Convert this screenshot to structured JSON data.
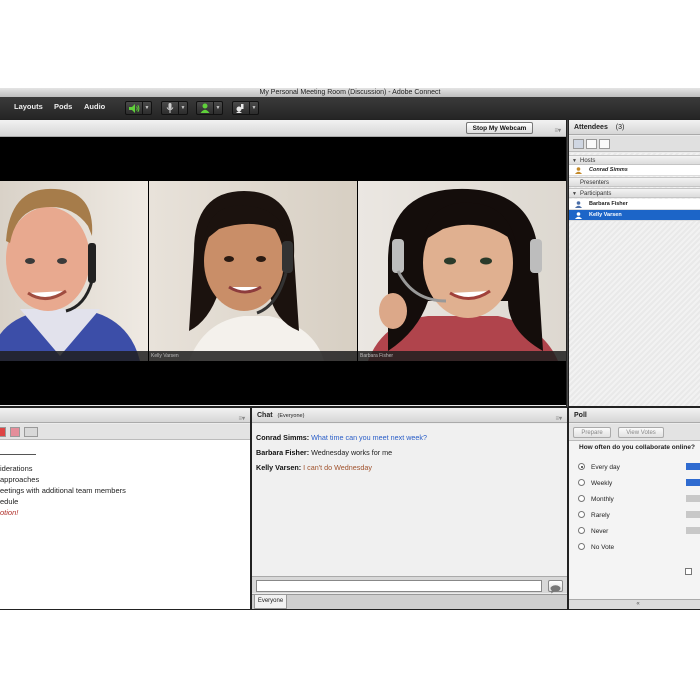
{
  "window": {
    "title": "My Personal Meeting Room (Discussion) - Adobe Connect"
  },
  "menubar": {
    "items": [
      {
        "label": "Layouts"
      },
      {
        "label": "Pods"
      },
      {
        "label": "Audio"
      }
    ],
    "toolbar": [
      {
        "icon": "speaker-icon",
        "color": "#5fd03a"
      },
      {
        "icon": "microphone-icon",
        "color": "#cfcfcf"
      },
      {
        "icon": "webcam-icon",
        "color": "#5fd03a"
      },
      {
        "icon": "raise-hand-icon",
        "color": "#e8e8e8"
      }
    ]
  },
  "video": {
    "webcam_button": "Stop My Webcam",
    "feeds": [
      {
        "label": ""
      },
      {
        "label": "Kelly Varsen"
      },
      {
        "label": "Barbara Fisher"
      }
    ]
  },
  "attendees": {
    "title": "Attendees",
    "count": "(3)",
    "groups": [
      {
        "name": "Hosts",
        "people": [
          {
            "name": "Conrad Simms"
          }
        ]
      },
      {
        "name": "Presenters",
        "people": []
      },
      {
        "name": "Participants",
        "people": [
          {
            "name": "Barbara Fisher"
          },
          {
            "name": "Kelly Varsen"
          }
        ]
      }
    ]
  },
  "notes": {
    "lines": [
      "iderations",
      "approaches",
      "eetings with additional team members",
      "edule",
      "otion!"
    ],
    "accent": "#b0302a"
  },
  "chat": {
    "title": "Chat",
    "audience": "(Everyone)",
    "messages": [
      {
        "sender": "Conrad Simms:",
        "text": "What time can you meet next week?",
        "color": "#2a5ec8"
      },
      {
        "sender": "Barbara Fisher:",
        "text": "Wednesday works for me",
        "color": "#222222"
      },
      {
        "sender": "Kelly Varsen:",
        "text": "I can't do Wednesday",
        "color": "#a0522d"
      }
    ],
    "tab": "Everyone"
  },
  "poll": {
    "title": "Poll",
    "prepare_label": "Prepare",
    "view_votes_label": "View Votes",
    "question": "How often do you collaborate online?",
    "options": [
      {
        "label": "Every day",
        "selected": true,
        "highlight": true
      },
      {
        "label": "Weekly",
        "selected": false,
        "highlight": true
      },
      {
        "label": "Monthly",
        "selected": false,
        "highlight": false
      },
      {
        "label": "Rarely",
        "selected": false,
        "highlight": false
      },
      {
        "label": "Never",
        "selected": false,
        "highlight": false
      },
      {
        "label": "No Vote",
        "selected": false,
        "highlight": false
      }
    ],
    "footer": "«"
  }
}
